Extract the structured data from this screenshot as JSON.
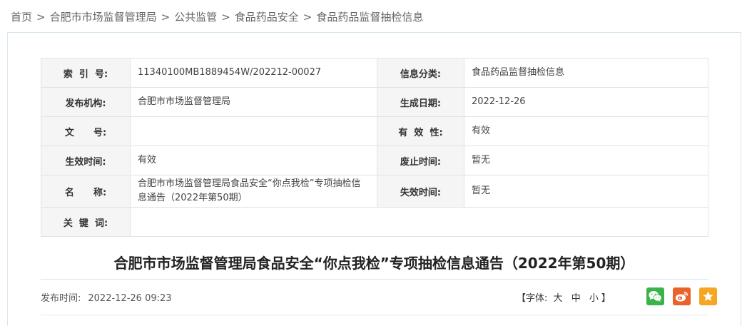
{
  "breadcrumb": {
    "items": [
      "首页",
      "合肥市市场监督管理局",
      "公共监管",
      "食品药品安全",
      "食品药品监督抽检信息"
    ],
    "separator": ">"
  },
  "meta": {
    "index_no_label": "索  引  号:",
    "index_no": "11340100MB1889454W/202212-00027",
    "category_label": "信息分类:",
    "category": "食品药品监督抽检信息",
    "issuer_label": "发布机构:",
    "issuer": "合肥市市场监督管理局",
    "gen_date_label": "生成日期:",
    "gen_date": "2022-12-26",
    "doc_no_label": "文      号:",
    "doc_no": "",
    "validity_label": "有  效  性:",
    "validity": "有效",
    "effective_time_label": "生效时间:",
    "effective_time": "有效",
    "repeal_time_label": "废止时间:",
    "repeal_time": "暂无",
    "name_label": "名      称:",
    "name": "合肥市市场监督管理局食品安全“你点我检”专项抽检信息通告（2022年第50期）",
    "expire_time_label": "失效时间:",
    "expire_time": "暂无",
    "keywords_label": "关  键  词:",
    "keywords": ""
  },
  "article": {
    "title": "合肥市市场监督管理局食品安全“你点我检”专项抽检信息通告（2022年第50期）",
    "publish_label": "发布时间:",
    "publish_time": "2022-12-26 09:23"
  },
  "font_size": {
    "open": "【字体:",
    "large": "大",
    "medium": "中",
    "small": "小",
    "close": "】"
  },
  "share": {
    "wechat_icon": "wechat-icon",
    "weibo_icon": "weibo-icon",
    "favorite_icon": "star-icon",
    "colors": {
      "wechat": "#3bb34a",
      "weibo": "#e8622a",
      "favorite": "#f5a623"
    }
  }
}
